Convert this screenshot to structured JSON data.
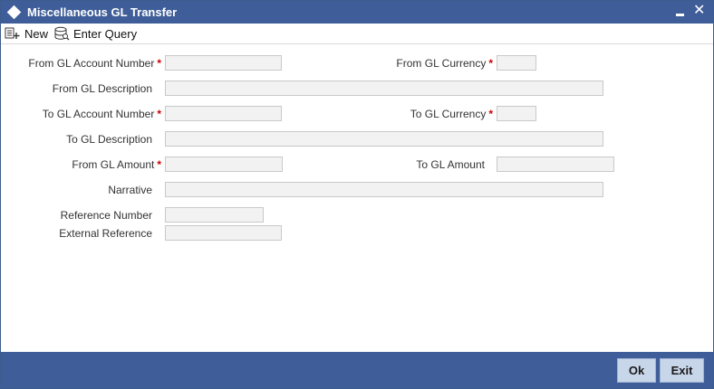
{
  "window": {
    "title": "Miscellaneous GL Transfer"
  },
  "toolbar": {
    "new_label": "New",
    "enter_query_label": "Enter Query"
  },
  "form": {
    "required_marker": "*",
    "from_gl_account_number": {
      "label": "From GL Account Number",
      "value": ""
    },
    "from_gl_currency": {
      "label": "From GL Currency",
      "value": ""
    },
    "from_gl_description": {
      "label": "From GL Description",
      "value": ""
    },
    "to_gl_account_number": {
      "label": "To GL Account Number",
      "value": ""
    },
    "to_gl_currency": {
      "label": "To GL Currency",
      "value": ""
    },
    "to_gl_description": {
      "label": "To GL Description",
      "value": ""
    },
    "from_gl_amount": {
      "label": "From GL Amount",
      "value": ""
    },
    "to_gl_amount": {
      "label": "To GL Amount",
      "value": ""
    },
    "narrative": {
      "label": "Narrative",
      "value": ""
    },
    "reference_number": {
      "label": "Reference Number",
      "value": ""
    },
    "external_reference": {
      "label": "External Reference",
      "value": ""
    }
  },
  "footer": {
    "ok_label": "Ok",
    "exit_label": "Exit"
  },
  "colors": {
    "titlebar": "#3f5e99",
    "required": "#cc0000",
    "button": "#c8d6ea"
  }
}
